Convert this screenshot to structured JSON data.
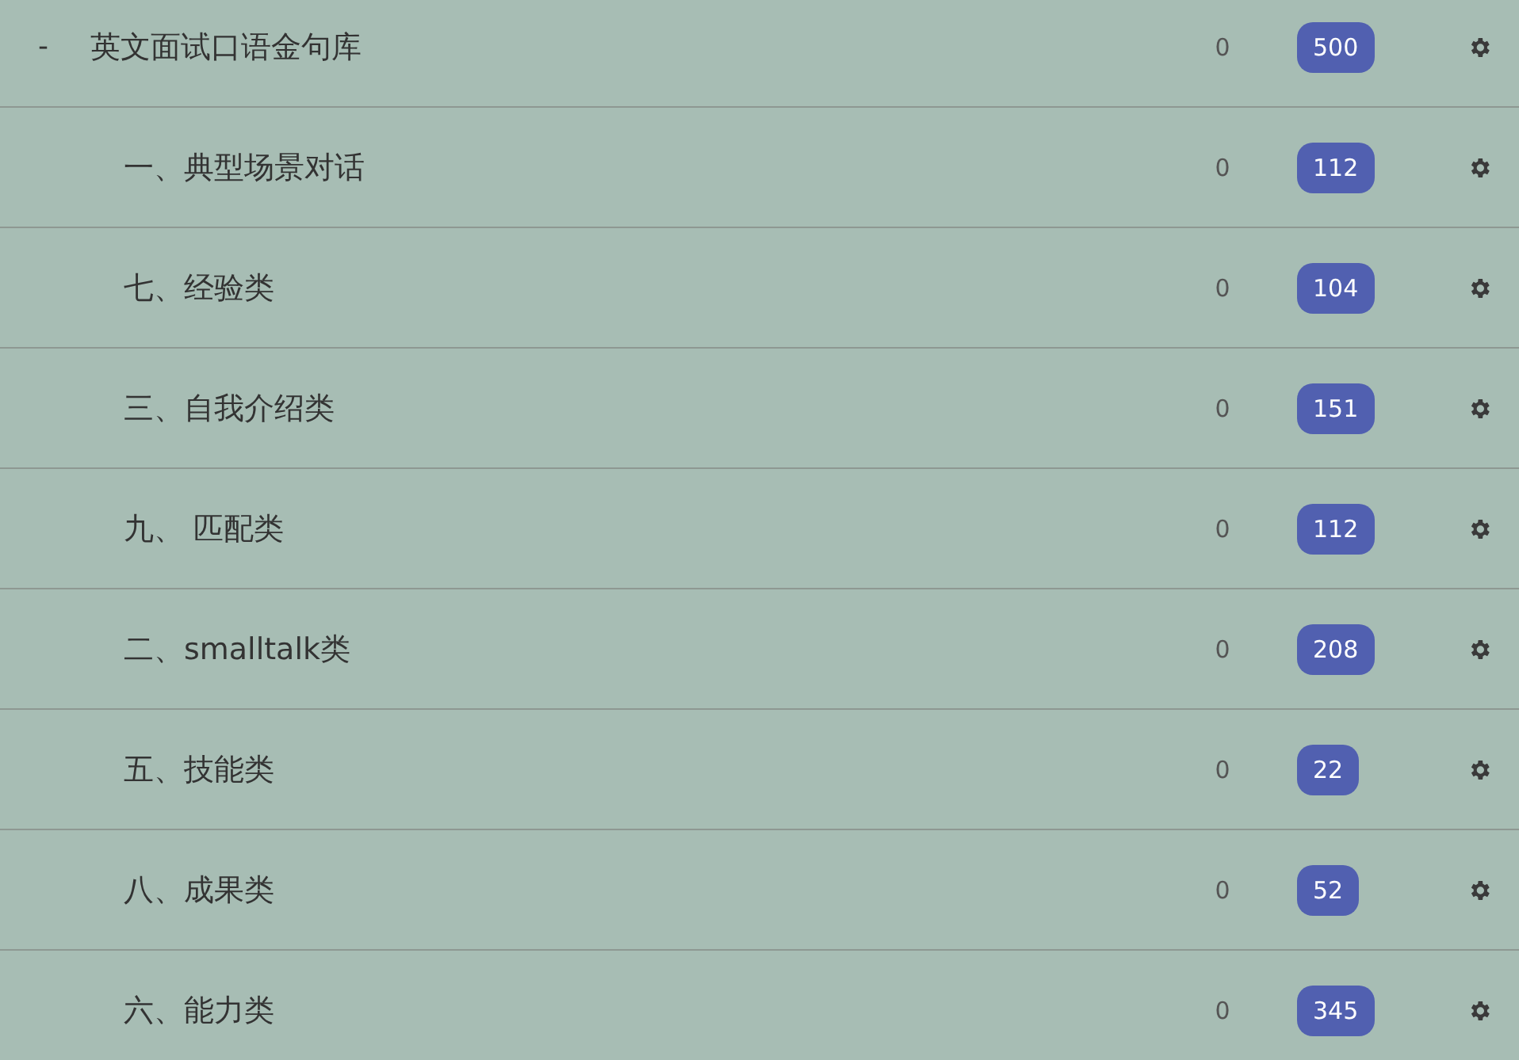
{
  "decks": [
    {
      "toggle": "-",
      "name": "英文面试口语金句库",
      "due": "0",
      "count": "500",
      "children": [
        {
          "name": "一、典型场景对话",
          "due": "0",
          "count": "112"
        },
        {
          "name": "七、经验类",
          "due": "0",
          "count": "104"
        },
        {
          "name": "三、自我介绍类",
          "due": "0",
          "count": "151"
        },
        {
          "name": "九、 匹配类",
          "due": "0",
          "count": "112"
        },
        {
          "name": "二、smalltalk类",
          "due": "0",
          "count": "208"
        },
        {
          "name": "五、技能类",
          "due": "0",
          "count": "22"
        },
        {
          "name": "八、成果类",
          "due": "0",
          "count": "52"
        },
        {
          "name": "六、能力类",
          "due": "0",
          "count": "345"
        }
      ]
    }
  ]
}
